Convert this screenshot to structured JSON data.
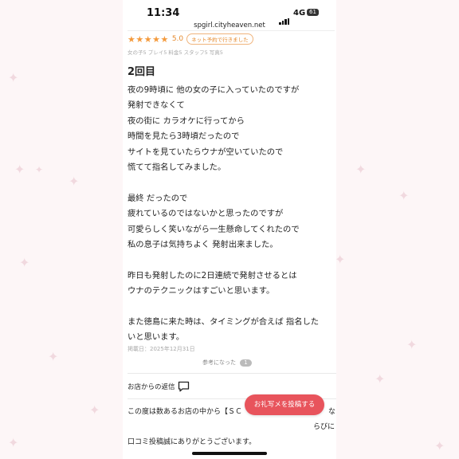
{
  "status_bar": {
    "time": "11:34",
    "network": "4G",
    "battery": "61"
  },
  "browser": {
    "url": "spgirl.cityheaven.net"
  },
  "review": {
    "stars": "★★★★★",
    "score": "5.0",
    "visit_badge": "ネット予約で行きました",
    "subscores": "女の子5 プレイ5 料金5 スタッフ5 写真5",
    "heading": "2回目",
    "body_lines": [
      "夜の9時頃に 他の女の子に入っていたのですが",
      "発射できなくて",
      "夜の街に カラオケに行ってから",
      "時間を見たら3時頃だったので",
      "サイトを見ていたらウナが空いていたので",
      "慌てて指名してみました。",
      "",
      "最終 だったので",
      "疲れているのではないかと思ったのですが",
      "可愛らしく笑いながら一生懸命してくれたので",
      "私の息子は気持ちよく 発射出来ました。",
      "",
      "昨日も発射したのに2日連続で発射させるとは",
      "ウナのテクニックはすごいと思います。",
      "",
      "また徳島に来た時は、タイミングが合えば 指名した",
      "いと思います。"
    ],
    "posted_date": "掲載日：2025年12月31日",
    "helpful_label": "参考になった",
    "helpful_count": "1"
  },
  "shop_reply": {
    "label": "お店からの返信",
    "lines": [
      "この度は数あるお店の中から【ＳＣ",
      "らびに",
      "口コミ投稿誠にありがとうございます。"
    ],
    "line1_tail": "な"
  },
  "actions": {
    "post_button": "お礼写メを投稿する"
  }
}
